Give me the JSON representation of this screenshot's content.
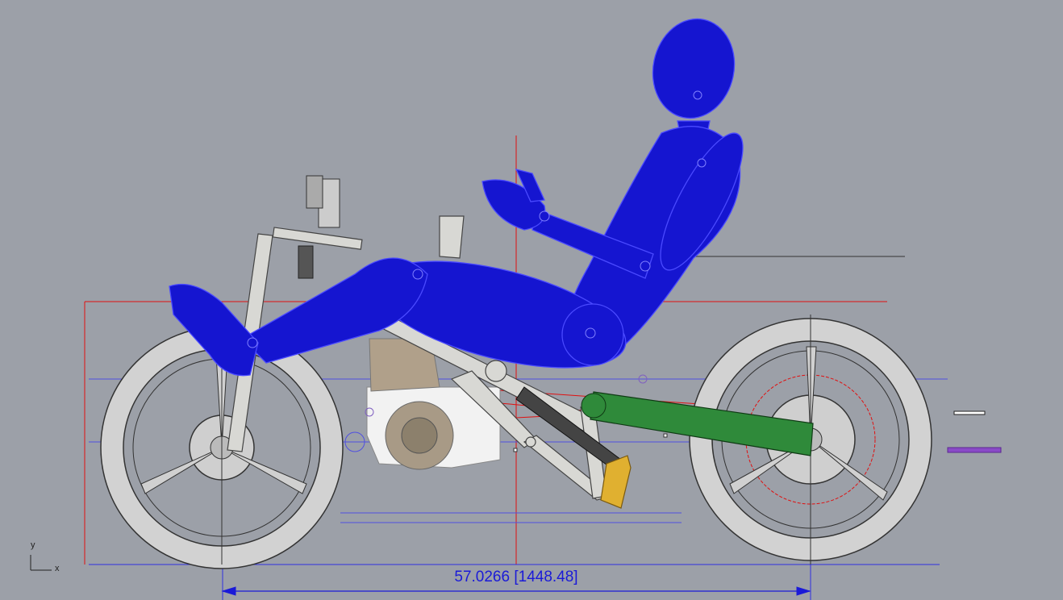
{
  "viewport": {
    "background": "#9ca0a8",
    "dimension": {
      "text": "57.0266 [1448.48]",
      "color": "#1a1ad8"
    },
    "axis": {
      "x_label": "x",
      "y_label": "y"
    },
    "colors": {
      "rider": "#1515d0",
      "rider_wire": "#4a4aff",
      "swingarm": "#2f8a3a",
      "bracket": "#e0b030",
      "frame": "#d8d8d4",
      "tire": "#cfcfcf",
      "guide_red": "#e01010",
      "guide_blue": "#3030e0",
      "layer_purple": "#8a4ac8"
    }
  }
}
